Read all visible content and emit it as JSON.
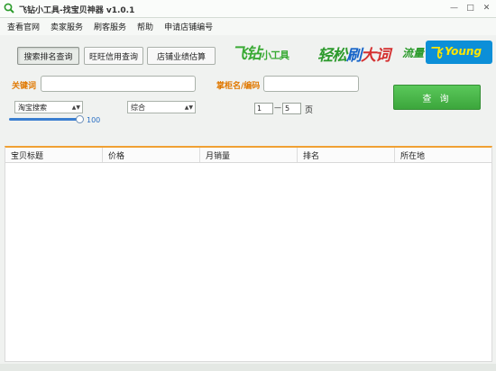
{
  "window": {
    "title": "飞钻小工具-找宝贝神器 v1.0.1",
    "buttons": [
      "—",
      "□",
      "✕"
    ]
  },
  "menu": [
    "查看官网",
    "卖家服务",
    "刷客服务",
    "帮助",
    "申请店铺编号"
  ],
  "tabs": [
    "搜索排名查询",
    "旺旺信用查询",
    "店铺业绩估算"
  ],
  "brand": {
    "part1_main": "飞钻",
    "part1_small": "小工具",
    "part2_a": "轻松",
    "part2_b": "刷",
    "part2_c": "大词",
    "part3_a": "流量",
    "part3_b": "飞",
    "part3_c": "Young"
  },
  "form": {
    "keyword_label": "关键词",
    "keyword_value": "",
    "shop_label": "掌柜名/编码",
    "shop_value": "",
    "search_type": "淘宝搜索",
    "sort_type": "综合",
    "slider_value": "100",
    "page_from": "1",
    "page_sep": "—",
    "page_to": "5",
    "page_unit": "页",
    "query_label": "查 询"
  },
  "table": {
    "columns": [
      "宝贝标题",
      "价格",
      "月销量",
      "排名",
      "所在地"
    ],
    "rows": []
  },
  "colors": {
    "accent": "#f0a032",
    "button": "#4cb84c",
    "label": "#e07800"
  }
}
